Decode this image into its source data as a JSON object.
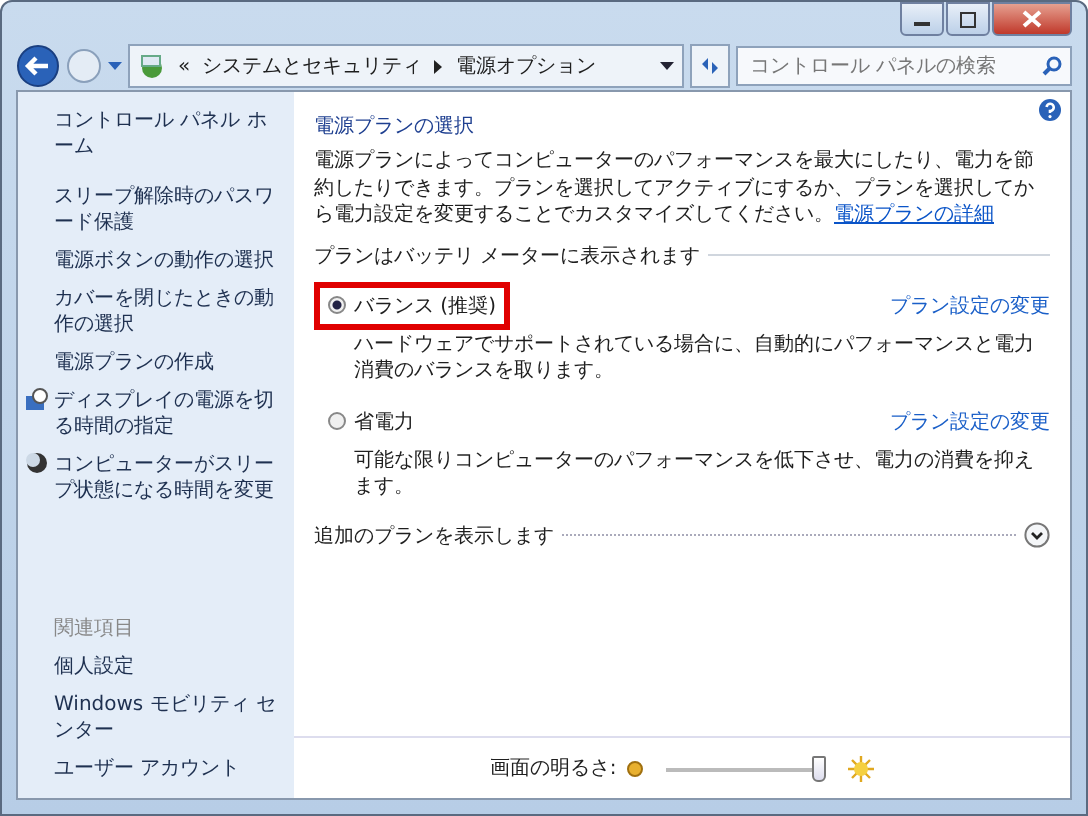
{
  "address": {
    "crumbs": [
      "«",
      "システムとセキュリティ",
      "電源オプション"
    ]
  },
  "search": {
    "placeholder": "コントロール パネルの検索"
  },
  "sidebar": {
    "home": "コントロール パネル ホーム",
    "items": [
      {
        "label": "スリープ解除時のパスワード保護",
        "kind": "plain"
      },
      {
        "label": "電源ボタンの動作の選択",
        "kind": "plain"
      },
      {
        "label": "カバーを閉じたときの動作の選択",
        "kind": "plain"
      },
      {
        "label": "電源プランの作成",
        "kind": "plain"
      },
      {
        "label": "ディスプレイの電源を切る時間の指定",
        "kind": "display"
      },
      {
        "label": "コンピューターがスリープ状態になる時間を変更",
        "kind": "sleep"
      }
    ],
    "related_heading": "関連項目",
    "related": [
      "個人設定",
      "Windows モビリティ センター",
      "ユーザー アカウント"
    ]
  },
  "main": {
    "title": "電源プランの選択",
    "intro": "電源プランによってコンピューターのパフォーマンスを最大にしたり、電力を節約したりできます。プランを選択してアクティブにするか、プランを選択してから電力設定を変更することでカスタマイズしてください。",
    "intro_link": "電源プランの詳細",
    "group_label": "プランはバッテリ メーターに表示されます",
    "plans": [
      {
        "name": "バランス (推奨)",
        "description": "ハードウェアでサポートされている場合に、自動的にパフォーマンスと電力消費のバランスを取ります。",
        "link": "プラン設定の変更",
        "selected": true,
        "highlighted": true
      },
      {
        "name": "省電力",
        "description": "可能な限りコンピューターのパフォーマンスを低下させ、電力の消費を抑えます。",
        "link": "プラン設定の変更",
        "selected": false,
        "highlighted": false
      }
    ],
    "more_plans": "追加のプランを表示します"
  },
  "brightness": {
    "label": "画面の明るさ:",
    "level": 0.95
  }
}
